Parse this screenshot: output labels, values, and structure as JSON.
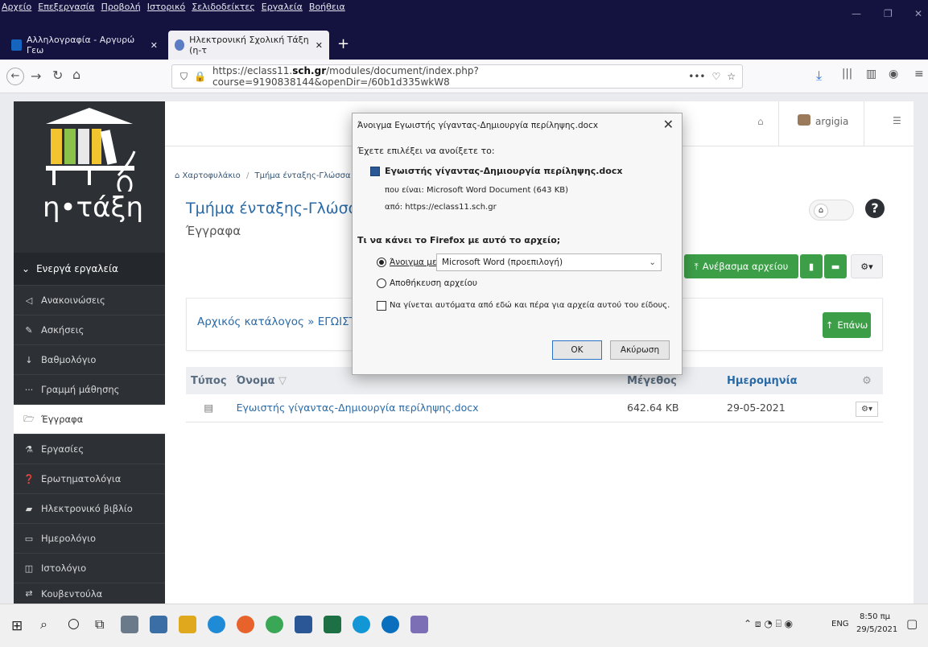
{
  "menubar": {
    "items": [
      "Αρχείο",
      "Επεξεργασία",
      "Προβολή",
      "Ιστορικό",
      "Σελιδοδείκτες",
      "Εργαλεία",
      "Βοήθεια"
    ]
  },
  "tabs": [
    {
      "label": "Αλληλογραφία - Αργυρώ Γεω",
      "close": "✕"
    },
    {
      "label": "Ηλεκτρονική Σχολική Τάξη (η-τ",
      "close": "✕"
    }
  ],
  "newtab": "+",
  "url": {
    "prefix": "https://eclass11.",
    "host": "sch.gr",
    "path": "/modules/document/index.php?course=9190838144&openDir=/60b1d335wkW8"
  },
  "urlbar": {
    "more": "•••"
  },
  "logo": {
    "name": "η•τάξη"
  },
  "sidebar": {
    "section": "Ενεργά εργαλεία",
    "items": [
      {
        "icon": "megaphone",
        "label": "Ανακοινώσεις"
      },
      {
        "icon": "edit",
        "label": "Ασκήσεις"
      },
      {
        "icon": "sort-numeric",
        "label": "Βαθμολόγιο"
      },
      {
        "icon": "ellipsis",
        "label": "Γραμμή μάθησης"
      },
      {
        "icon": "folder-open",
        "label": "Έγγραφα"
      },
      {
        "icon": "flask",
        "label": "Εργασίες"
      },
      {
        "icon": "question-circle",
        "label": "Ερωτηματολόγια"
      },
      {
        "icon": "book",
        "label": "Ηλεκτρονικό βιβλίο"
      },
      {
        "icon": "calendar",
        "label": "Ημερολόγιο"
      },
      {
        "icon": "columns",
        "label": "Ιστολόγιο"
      },
      {
        "icon": "exchange",
        "label": "Κουβεντούλα"
      }
    ]
  },
  "header": {
    "user": "argigia"
  },
  "breadcrumb": {
    "home": "Χαρτοφυλάκιο",
    "sep": "/",
    "course": "Τμήμα ένταξης-Γλώσσα"
  },
  "course": {
    "title": "Τμήμα ένταξης-Γλώσσα",
    "subtitle": "Έγγραφα",
    "help": "?"
  },
  "toolbar": {
    "upload": "Ανέβασμα αρχείου"
  },
  "directory": {
    "path": "Αρχικός κατάλογος » ΕΓΩΙΣΤΗΣ Γ",
    "up": "Επάνω"
  },
  "table": {
    "headers": {
      "type": "Τύπος",
      "name": "Όνομα",
      "size": "Μέγεθος",
      "date": "Ημερομηνία"
    },
    "rows": [
      {
        "name": "Εγωιστής γίγαντας-Δημιουργία περίληψης.docx",
        "size": "642.64 KB",
        "date": "29-05-2021"
      }
    ]
  },
  "dialog": {
    "title": "Άνοιγμα Εγωιστής γίγαντας-Δημιουργία περίληψης.docx",
    "close": "✕",
    "intro": "Έχετε επιλέξει να ανοίξετε το:",
    "filename": "Εγωιστής γίγαντας-Δημιουργία περίληψης.docx",
    "type_line": "που είναι: Microsoft Word Document (643 KB)",
    "from_line": "από: https://eclass11.sch.gr",
    "question": "Τι να κάνει το Firefox με αυτό το αρχείο;",
    "open_with_label": "Άνοιγμα με",
    "open_with_value": "Microsoft Word (προεπιλογή)",
    "save_label": "Αποθήκευση αρχείου",
    "auto_label": "Να γίνεται αυτόματα από εδώ και πέρα για αρχεία αυτού του είδους.",
    "ok": "OK",
    "cancel": "Ακύρωση"
  },
  "taskbar": {
    "lang": "ENG",
    "time": "8:50 πμ",
    "date": "29/5/2021"
  }
}
